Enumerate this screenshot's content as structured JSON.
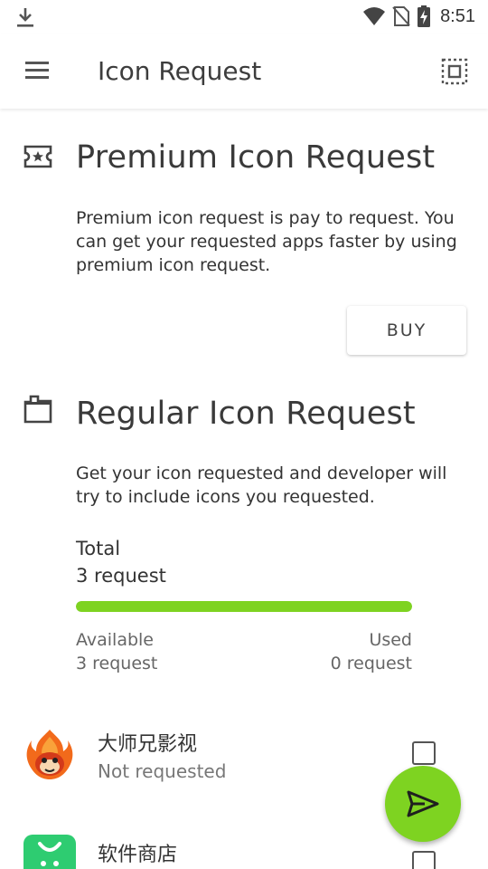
{
  "status_bar": {
    "time": "8:51"
  },
  "app_bar": {
    "title": "Icon Request"
  },
  "premium": {
    "title": "Premium Icon Request",
    "description": "Premium icon request is pay to request. You can get your requested apps faster by using premium icon request.",
    "buy_label": "BUY"
  },
  "regular": {
    "title": "Regular Icon Request",
    "description": "Get your icon requested and developer will try to include icons you requested.",
    "total_label": "Total",
    "total_value": "3 request",
    "progress_fraction": 1.0,
    "available_label": "Available",
    "available_value": "3 request",
    "used_label": "Used",
    "used_value": "0 request"
  },
  "apps": [
    {
      "name": "大师兄影视",
      "status": "Not requested"
    },
    {
      "name": "软件商店",
      "status": ""
    }
  ],
  "colors": {
    "accent": "#7ed321"
  }
}
